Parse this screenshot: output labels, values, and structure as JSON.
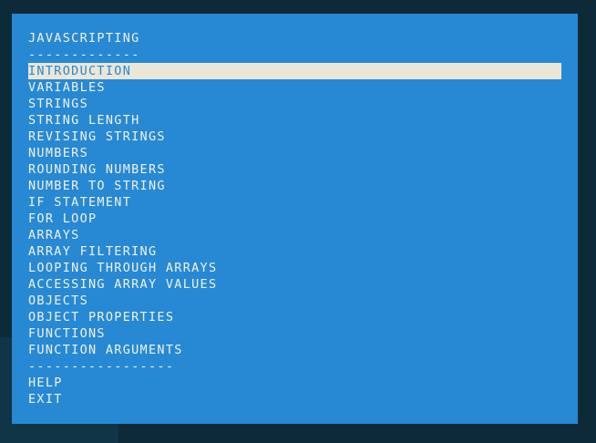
{
  "colors": {
    "background": "#0d2a38",
    "panel": "#2789d4",
    "text": "#f1f1ea",
    "highlight": "#ece6d6"
  },
  "menu": {
    "title": "JAVASCRIPTING",
    "title_rule": "-------------",
    "selected_index": 0,
    "items": [
      "INTRODUCTION",
      "VARIABLES",
      "STRINGS",
      "STRING LENGTH",
      "REVISING STRINGS",
      "NUMBERS",
      "ROUNDING NUMBERS",
      "NUMBER TO STRING",
      "IF STATEMENT",
      "FOR LOOP",
      "ARRAYS",
      "ARRAY FILTERING",
      "LOOPING THROUGH ARRAYS",
      "ACCESSING ARRAY VALUES",
      "OBJECTS",
      "OBJECT PROPERTIES",
      "FUNCTIONS",
      "FUNCTION ARGUMENTS"
    ],
    "footer_rule": "-----------------",
    "help_label": "HELP",
    "exit_label": "EXIT"
  }
}
